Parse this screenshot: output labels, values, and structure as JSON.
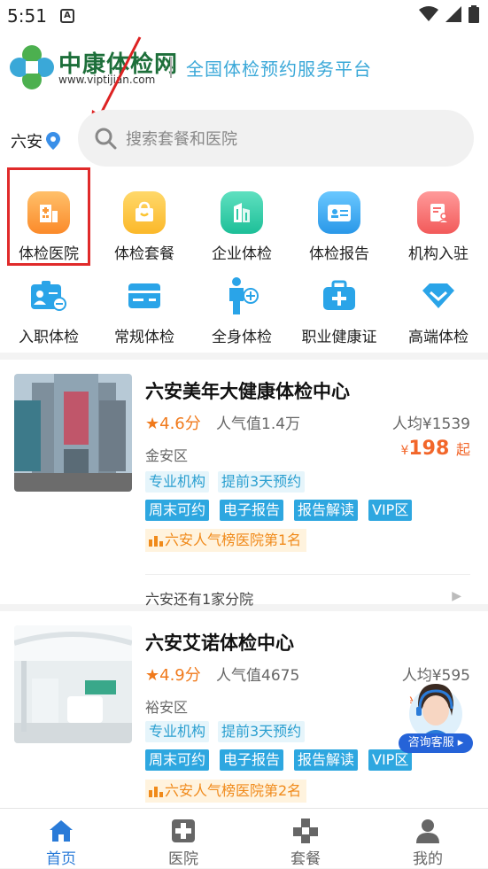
{
  "status_bar": {
    "time": "5:51",
    "notif_icon": "A"
  },
  "header": {
    "brand": "中康体检网",
    "brand_url": "www.viptijian.com",
    "slogan": "全国体检预约服务平台"
  },
  "location": {
    "city": "六安"
  },
  "search": {
    "placeholder": "搜索套餐和医院"
  },
  "categories": [
    {
      "label": "体检医院",
      "icon": "hospital-building-icon",
      "color": "#fb9a3a"
    },
    {
      "label": "体检套餐",
      "icon": "gift-bag-icon",
      "color": "#fbc431"
    },
    {
      "label": "企业体检",
      "icon": "office-building-icon",
      "color": "#2ec9a6"
    },
    {
      "label": "体检报告",
      "icon": "id-card-icon",
      "color": "#36a9f0"
    },
    {
      "label": "机构入驻",
      "icon": "document-user-icon",
      "color": "#f76c6c"
    },
    {
      "label": "入职体检",
      "icon": "employee-badge-icon",
      "color": "#2aa4e8"
    },
    {
      "label": "常规体检",
      "icon": "card-icon",
      "color": "#2aa4e8"
    },
    {
      "label": "全身体检",
      "icon": "body-plus-icon",
      "color": "#2aa4e8"
    },
    {
      "label": "职业健康证",
      "icon": "medical-kit-icon",
      "color": "#2aa4e8"
    },
    {
      "label": "高端体检",
      "icon": "diamond-icon",
      "color": "#2aa4e8"
    }
  ],
  "hospitals": [
    {
      "name": "六安美年大健康体检中心",
      "rating": "★4.6分",
      "popularity": "人气值1.4万",
      "avg_price": "人均¥1539",
      "district": "金安区",
      "price_symbol": "¥",
      "price": "198",
      "price_unit": "起",
      "tags_light": [
        "专业机构",
        "提前3天预约"
      ],
      "tags_solid": [
        "周末可约",
        "电子报告",
        "报告解读",
        "VIP区"
      ],
      "rank": "六安人气榜医院第1名",
      "branch": "六安还有1家分院"
    },
    {
      "name": "六安艾诺体检中心",
      "rating": "★4.9分",
      "popularity": "人气值4675",
      "avg_price": "人均¥595",
      "district": "裕安区",
      "price_symbol": "¥",
      "tags_light": [
        "专业机构",
        "提前3天预约"
      ],
      "tags_solid": [
        "周末可约",
        "电子报告",
        "报告解读",
        "VIP区"
      ],
      "rank": "六安人气榜医院第2名"
    }
  ],
  "customer_service": {
    "label": "咨询客服 ▸"
  },
  "tabbar": [
    {
      "label": "首页",
      "icon": "home-icon",
      "active": true
    },
    {
      "label": "医院",
      "icon": "hospital-cross-icon",
      "active": false
    },
    {
      "label": "套餐",
      "icon": "package-icon",
      "active": false
    },
    {
      "label": "我的",
      "icon": "user-icon",
      "active": false
    }
  ],
  "colors": {
    "accent": "#2a7bd8",
    "price": "#f2662a",
    "tag_blue": "#2ea7e0",
    "highlight_box": "#e02a2a"
  }
}
